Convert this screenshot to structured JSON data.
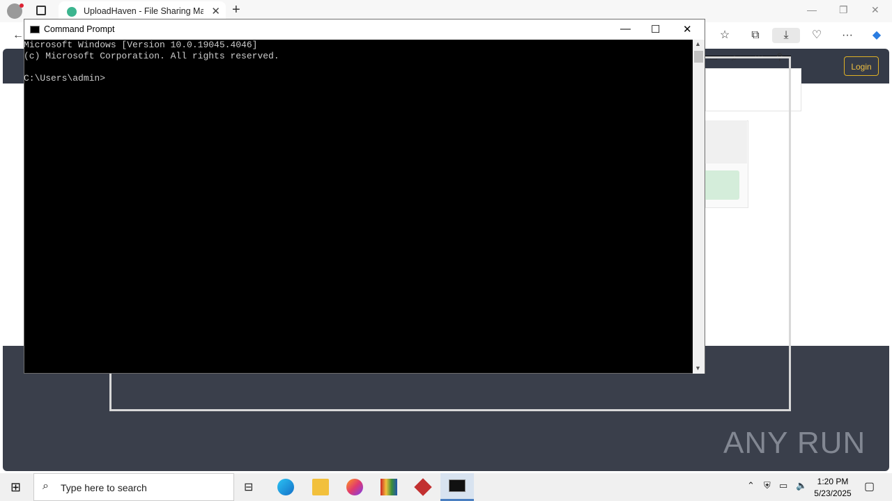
{
  "browser": {
    "tab_title": "UploadHaven - File Sharing Made",
    "new_tab_symbol": "+",
    "window_controls": [
      "—",
      "❐",
      "✕"
    ]
  },
  "page": {
    "login_label": "Login"
  },
  "cmd": {
    "title": "Command Prompt",
    "lines": [
      "Microsoft Windows [Version 10.0.19045.4046]",
      "(c) Microsoft Corporation. All rights reserved.",
      "",
      "C:\\Users\\admin>"
    ],
    "text": "Microsoft Windows [Version 10.0.19045.4046]\n(c) Microsoft Corporation. All rights reserved.\n\nC:\\Users\\admin>"
  },
  "taskbar": {
    "search_placeholder": "Type here to search",
    "time": "1:20 PM",
    "date": "5/23/2025"
  },
  "watermark": "ANY RUN",
  "colors": {
    "page_header": "#353b48",
    "page_footer": "#3a3f4b",
    "login_accent": "#f0c040",
    "cmd_bg": "#000000",
    "cmd_fg": "#cccccc"
  }
}
